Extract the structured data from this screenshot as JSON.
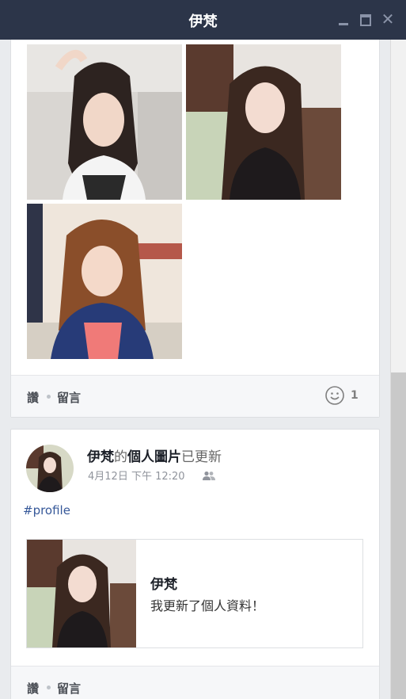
{
  "window": {
    "title": "伊梵"
  },
  "post1": {
    "actions": {
      "like": "讚",
      "comment": "留言"
    },
    "reaction_count": "1"
  },
  "post2": {
    "author": "伊梵",
    "action_pre": "的",
    "action_object": "個人圖片",
    "action_post": "已更新",
    "timestamp": "4月12日 下午 12:20",
    "hashtag": "#profile",
    "link": {
      "title": "伊梵",
      "description": "我更新了個人資料！"
    },
    "actions": {
      "like": "讚",
      "comment": "留言"
    }
  },
  "icons": {
    "minimize": "minimize-icon",
    "maximize": "maximize-icon",
    "close": "close-icon",
    "reaction": "smile-icon",
    "audience": "friends-icon"
  },
  "colors": {
    "titlebar": "#2c3549",
    "link": "#365899",
    "background": "#e9ebee"
  }
}
